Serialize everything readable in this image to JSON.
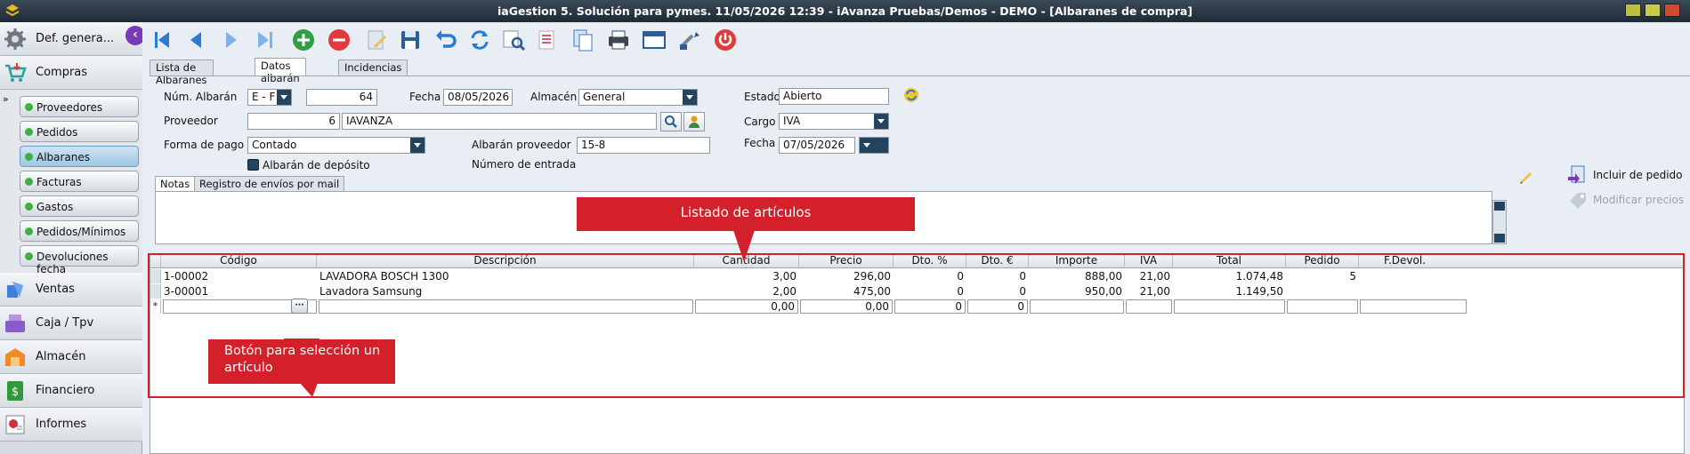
{
  "window": {
    "title": "iaGestion 5. Solución para pymes.   11/05/2026 12:39  -  iAvanza Pruebas/Demos - DEMO - [Albaranes de compra]",
    "accent": "#24435f"
  },
  "sidebar": {
    "sections": [
      {
        "label": "Def. genera...",
        "icon": "gear-icon"
      },
      {
        "label": "Compras",
        "icon": "cart-icon"
      },
      {
        "label": "Ventas",
        "icon": "sales-icon"
      },
      {
        "label": "Caja / Tpv",
        "icon": "cash-register-icon"
      },
      {
        "label": "Almacén",
        "icon": "warehouse-icon"
      },
      {
        "label": "Financiero",
        "icon": "money-icon"
      },
      {
        "label": "Informes",
        "icon": "report-icon"
      }
    ],
    "items": [
      {
        "label": "Proveedores"
      },
      {
        "label": "Pedidos"
      },
      {
        "label": "Albaranes"
      },
      {
        "label": "Facturas"
      },
      {
        "label": "Gastos"
      },
      {
        "label": "Pedidos/Mínimos"
      },
      {
        "label": "Devoluciones fecha"
      }
    ]
  },
  "tabs": [
    "Lista de Albaranes",
    "Datos albarán",
    "Incidencias"
  ],
  "form": {
    "num_albaran_label": "Núm. Albarán",
    "serie_value": "E   - F",
    "numero_value": "64",
    "fecha_label": "Fecha",
    "fecha_value": "08/05/2026",
    "almacen_label": "Almacén",
    "almacen_value": "General",
    "estado_label": "Estado",
    "estado_value": "Abierto",
    "proveedor_label": "Proveedor",
    "proveedor_code": "6",
    "proveedor_name": "IAVANZA",
    "cargo_label": "Cargo",
    "cargo_value": "IVA",
    "forma_pago_label": "Forma de pago",
    "forma_pago_value": "Contado",
    "albaran_proveedor_label": "Albarán proveedor",
    "albaran_proveedor_value": "15-8",
    "fecha2_label": "Fecha",
    "fecha2_value": "07/05/2026",
    "deposito_label": "Albarán de depósito",
    "numero_entrada_label": "Número de entrada"
  },
  "subtabs": [
    "Notas",
    "Registro de envíos por mail"
  ],
  "actions": {
    "incluir_pedido": "Incluir de pedido",
    "modificar_precios": "Modificar precios"
  },
  "grid": {
    "columns": [
      "Código",
      "Descripción",
      "Cantidad",
      "Precio",
      "Dto. %",
      "Dto. €",
      "Importe",
      "IVA",
      "Total",
      "Pedido",
      "F.Devol."
    ],
    "rows": [
      [
        "1-00002",
        "LAVADORA BOSCH 1300",
        "3,00",
        "296,00",
        "0",
        "0",
        "888,00",
        "21,00",
        "1.074,48",
        "5",
        ""
      ],
      [
        "3-00001",
        "Lavadora Samsung",
        "2,00",
        "475,00",
        "0",
        "0",
        "950,00",
        "21,00",
        "1.149,50",
        "",
        ""
      ]
    ],
    "new_row": [
      "",
      "",
      "0,00",
      "0,00",
      "0",
      "0",
      "",
      "",
      "",
      "",
      ""
    ],
    "new_row_marker": "*",
    "lookup_button": "···"
  },
  "annotations": {
    "listado": "Listado de artículos",
    "boton": "Botón para selección un artículo"
  }
}
